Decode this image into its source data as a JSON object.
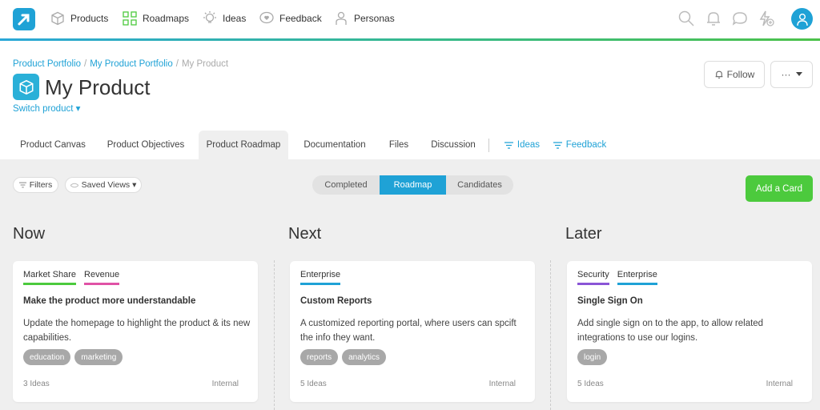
{
  "nav": {
    "items": [
      {
        "label": "Products",
        "icon": "box-icon"
      },
      {
        "label": "Roadmaps",
        "icon": "roadmap-grid-icon"
      },
      {
        "label": "Ideas",
        "icon": "lightbulb-icon"
      },
      {
        "label": "Feedback",
        "icon": "feedback-heart-icon"
      },
      {
        "label": "Personas",
        "icon": "persona-icon"
      }
    ],
    "right_icons": [
      "search-icon",
      "bell-icon",
      "chat-icon",
      "lightning-add-icon"
    ],
    "avatar_icon": "user-avatar-icon",
    "accent": "#1fa2d6"
  },
  "breadcrumb": {
    "items": [
      "Product Portfolio",
      "My Product Portfolio"
    ],
    "current": "My Product",
    "separator": "/"
  },
  "header": {
    "title": "My Product",
    "switch_label": "Switch product ▾",
    "follow_label": "Follow",
    "more_label": "···"
  },
  "tabs": [
    {
      "label": "Product Canvas",
      "active": false
    },
    {
      "label": "Product Objectives",
      "active": false
    },
    {
      "label": "Product Roadmap",
      "active": true
    },
    {
      "label": "Documentation",
      "active": false
    },
    {
      "label": "Files",
      "active": false
    },
    {
      "label": "Discussion",
      "active": false
    },
    {
      "label": "Ideas",
      "active": false,
      "link": true
    },
    {
      "label": "Feedback",
      "active": false,
      "link": true
    }
  ],
  "toolbar": {
    "filters_label": "Filters",
    "saved_views_label": "Saved Views ▾",
    "segments": [
      {
        "label": "Completed",
        "active": false
      },
      {
        "label": "Roadmap",
        "active": true
      },
      {
        "label": "Candidates",
        "active": false
      }
    ],
    "add_card_label": "Add a Card",
    "add_color": "#4cca3d"
  },
  "columns": [
    {
      "title": "Now",
      "card": {
        "tags": [
          {
            "label": "Market Share",
            "color": "#4cca3d"
          },
          {
            "label": "Revenue",
            "color": "#e052a6"
          }
        ],
        "title": "Make the product more understandable",
        "description": "Update the homepage to highlight the product & its new capabilities.",
        "labels": [
          "education",
          "marketing"
        ],
        "ideas": "3 Ideas",
        "visibility": "Internal"
      }
    },
    {
      "title": "Next",
      "card": {
        "tags": [
          {
            "label": "Enterprise",
            "color": "#1fa2d6"
          }
        ],
        "title": "Custom Reports",
        "description": "A customized reporting portal, where users can spcift the info they want.",
        "labels": [
          "reports",
          "analytics"
        ],
        "ideas": "5 Ideas",
        "visibility": "Internal"
      }
    },
    {
      "title": "Later",
      "card": {
        "tags": [
          {
            "label": "Security",
            "color": "#8a55d6"
          },
          {
            "label": "Enterprise",
            "color": "#1fa2d6"
          }
        ],
        "title": "Single Sign On",
        "description": "Add single sign on to the app, to allow related integrations to use our logins.",
        "labels": [
          "login"
        ],
        "ideas": "5 Ideas",
        "visibility": "Internal"
      }
    }
  ]
}
